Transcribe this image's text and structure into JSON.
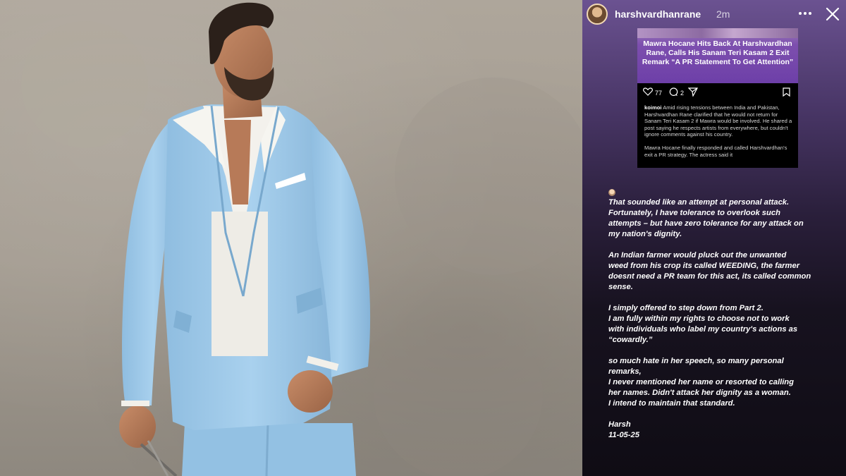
{
  "story": {
    "username": "harshvardhanrane",
    "time": "2m",
    "more_icon": "more-horizontal-icon",
    "close_icon": "close-icon",
    "post": {
      "headline": "Mawra Hocane Hits Back At Harshvardhan Rane, Calls His Sanam Teri Kasam 2 Exit Remark “A PR Statement To Get Attention”",
      "likes": "77",
      "comments": "2",
      "caption_user": "koimoi",
      "caption_p1": "Amid rising tensions between India and Pakistan, Harshvardhan Rane clarified that he would not return for Sanam Teri Kasam 2 if Mawra would be involved. He shared a post saying he respects artists from everywhere, but couldn't ignore comments against his country.",
      "caption_p2": "Mawra Hocane finally responded and called Harshvardhan's exit a PR strategy. The actress said it"
    },
    "text": {
      "p1": [
        "That sounded like an attempt at personal attack.",
        "Fortunately, I have tolerance to overlook such",
        "attempts – but have zero tolerance for any attack on",
        "my nation's dignity."
      ],
      "p2": [
        "An Indian farmer would pluck out the unwanted",
        "weed from his crop its called WEEDING, the farmer",
        "doesnt need a PR team for this act, its called common",
        "sense."
      ],
      "p3": [
        "I simply offered to step down from Part 2.",
        "I am fully within my rights to choose not to work",
        "with individuals who label my country's actions as",
        "“cowardly.”"
      ],
      "p4": [
        "so much hate in her speech, so many personal",
        "remarks,",
        "I never mentioned her name or resorted to calling",
        "her names. Didn't attack her dignity as a woman.",
        "I intend to maintain that standard."
      ],
      "signature": "Harsh",
      "date": "11-05-25"
    }
  },
  "colors": {
    "story_top": "#6b5291",
    "story_bottom": "#0f0c14",
    "suit": "#9cc8e6",
    "wall": "#a9a195"
  }
}
